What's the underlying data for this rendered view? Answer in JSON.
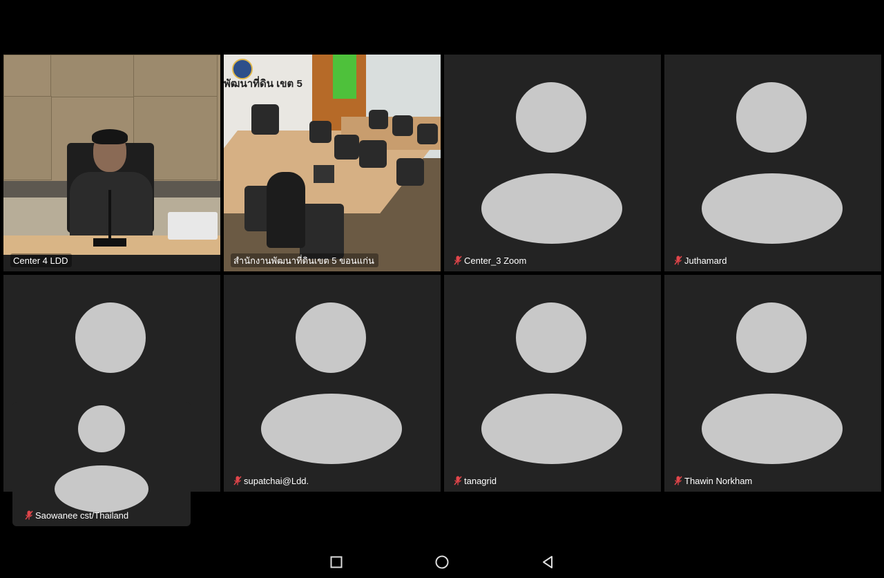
{
  "participants": [
    {
      "name": "Center 4 LDD",
      "muted": false,
      "video": true
    },
    {
      "name": "สำนักงานพัฒนาที่ดินเขต 5 ขอนแก่น",
      "muted": false,
      "video": true
    },
    {
      "name": "Center_3 Zoom",
      "muted": true,
      "video": false
    },
    {
      "name": "Juthamard",
      "muted": true,
      "video": false
    },
    {
      "name": "supatchai@Ldd.",
      "muted": true,
      "video": false
    },
    {
      "name": "tanagrid",
      "muted": true,
      "video": false
    },
    {
      "name": "Thawin Norkham",
      "muted": true,
      "video": false
    }
  ],
  "self_view": {
    "name": "Saowanee cst/Thailand",
    "muted": true
  },
  "room_sign": "พัฒนาที่ดิน เขต 5",
  "colors": {
    "active_speaker_border": "#7ed957",
    "mic_off": "#e0454a",
    "tile_bg": "#232323",
    "avatar": "#c8c8c8"
  },
  "nav_icons": [
    "recent-apps-icon",
    "home-icon",
    "back-icon"
  ]
}
